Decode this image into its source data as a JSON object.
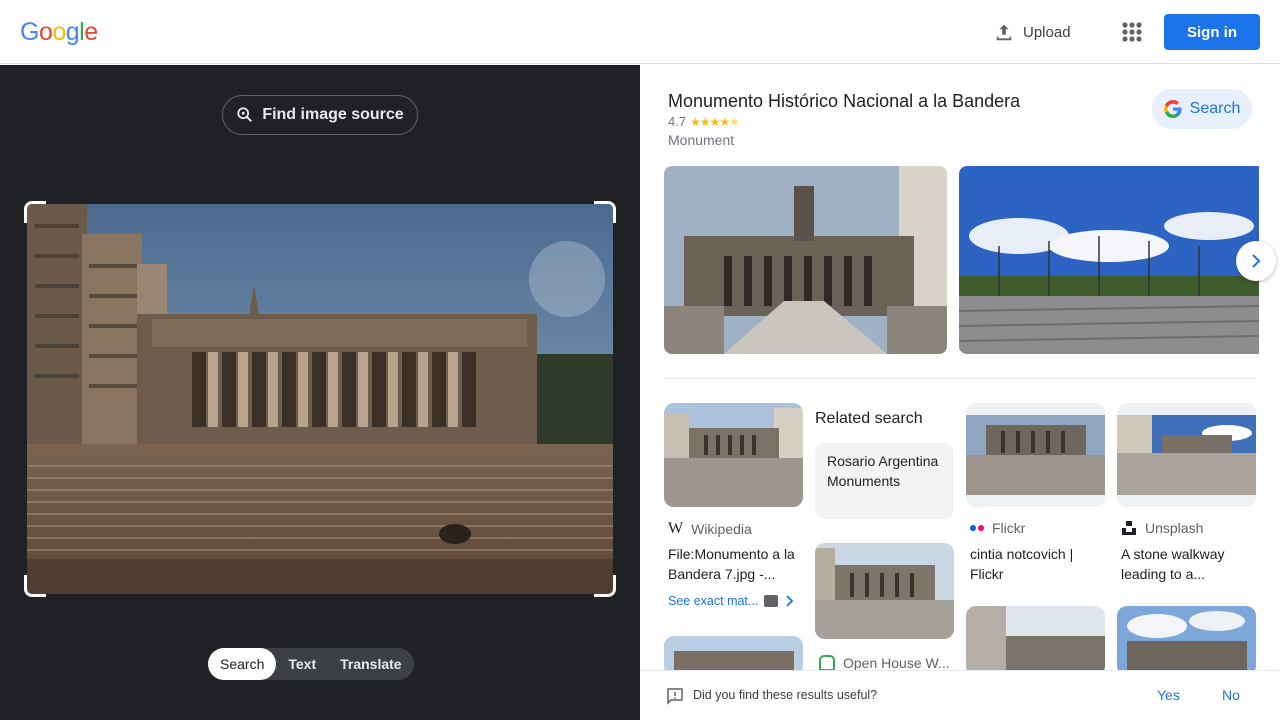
{
  "header": {
    "logo_letters": [
      "G",
      "o",
      "o",
      "g",
      "l",
      "e"
    ],
    "logo_colors": [
      "#4285f4",
      "#ea4335",
      "#fbbc05",
      "#4285f4",
      "#34a853",
      "#ea4335"
    ],
    "upload_label": "Upload",
    "upload_icon": "upload-icon",
    "apps_icon": "apps-grid-icon",
    "signin_label": "Sign in"
  },
  "left": {
    "find_source_label": "Find image source",
    "find_source_icon": "lens-search-icon",
    "modes": [
      "Search",
      "Text",
      "Translate"
    ],
    "active_mode": "Search"
  },
  "knowledge_panel": {
    "title": "Monumento Histórico Nacional a la Bandera",
    "rating": "4.7",
    "stars": 4.7,
    "type": "Monument",
    "search_label": "Search"
  },
  "results": {
    "card1": {
      "source": "Wikipedia",
      "caption": "File:Monumento a la Bandera 7.jpg -...",
      "see_exact": "See exact mat..."
    },
    "related_heading": "Related search",
    "related_chip": "Rosario Argentina Monuments",
    "card3": {
      "source": "Flickr",
      "caption": "cintia notcovich | Flickr"
    },
    "card4": {
      "source": "Unsplash",
      "caption": "A stone walkway leading to a..."
    },
    "card5": {
      "source": "Open House W..."
    }
  },
  "feedback": {
    "question": "Did you find these results useful?",
    "yes": "Yes",
    "no": "No"
  },
  "colors": {
    "accent": "#1a73e8",
    "dark_pane": "#202124",
    "star": "#fbbc04"
  }
}
